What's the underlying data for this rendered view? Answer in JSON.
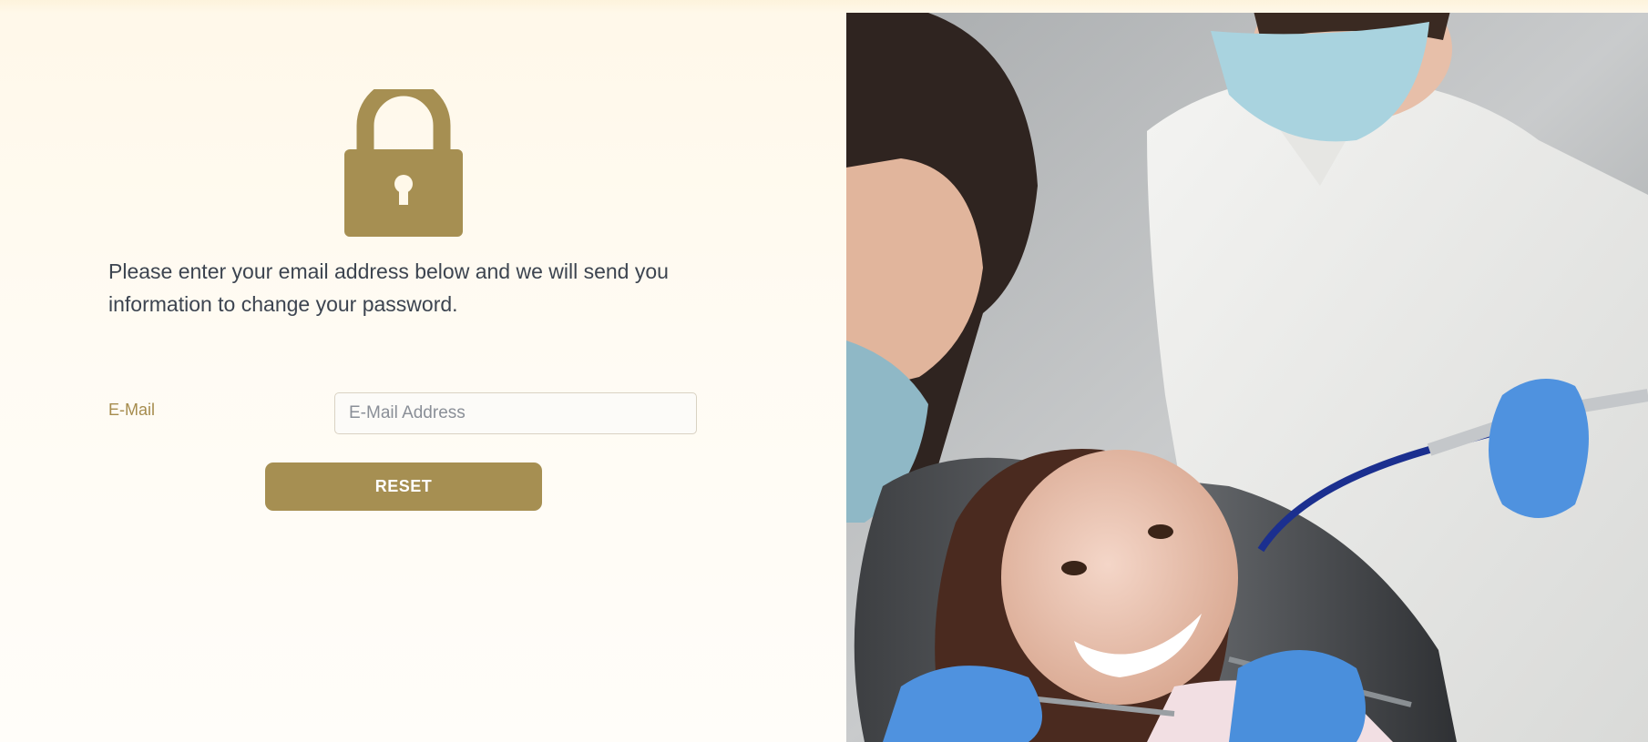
{
  "form": {
    "message": "Please enter your email address below and we will send you information to change your password.",
    "email_label": "E-Mail",
    "email_placeholder": "E-Mail Address",
    "email_value": "",
    "reset_label": "RESET"
  },
  "icons": {
    "lock": "lock-icon"
  },
  "photo": {
    "subject": "dental-checkup-photo"
  },
  "colors": {
    "accent": "#a68f52",
    "label": "#a68c4d",
    "text": "#3c4450",
    "background": "#fff8e9"
  }
}
